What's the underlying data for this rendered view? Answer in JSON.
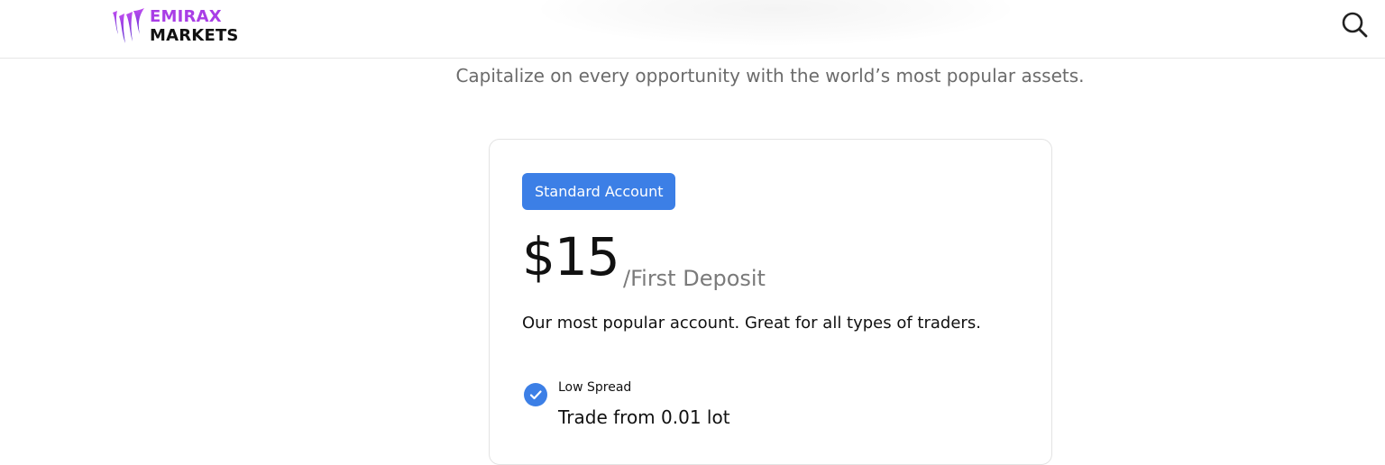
{
  "header": {
    "logo": {
      "top_text": "EMIRAX",
      "bottom_text": "MARKETS",
      "accent_color": "#a93ee6"
    },
    "search_icon": "search-icon"
  },
  "tagline": "Capitalize on every opportunity with the world’s most popular assets.",
  "card": {
    "badge": "Standard Account",
    "badge_color": "#3c7fe6",
    "price": "$15",
    "price_suffix": "/First Deposit",
    "description": "Our most popular account. Great for all types of traders.",
    "features": [
      {
        "icon": "check-circle-icon",
        "label": "Low Spread",
        "value": "Trade from 0.01 lot"
      }
    ]
  }
}
